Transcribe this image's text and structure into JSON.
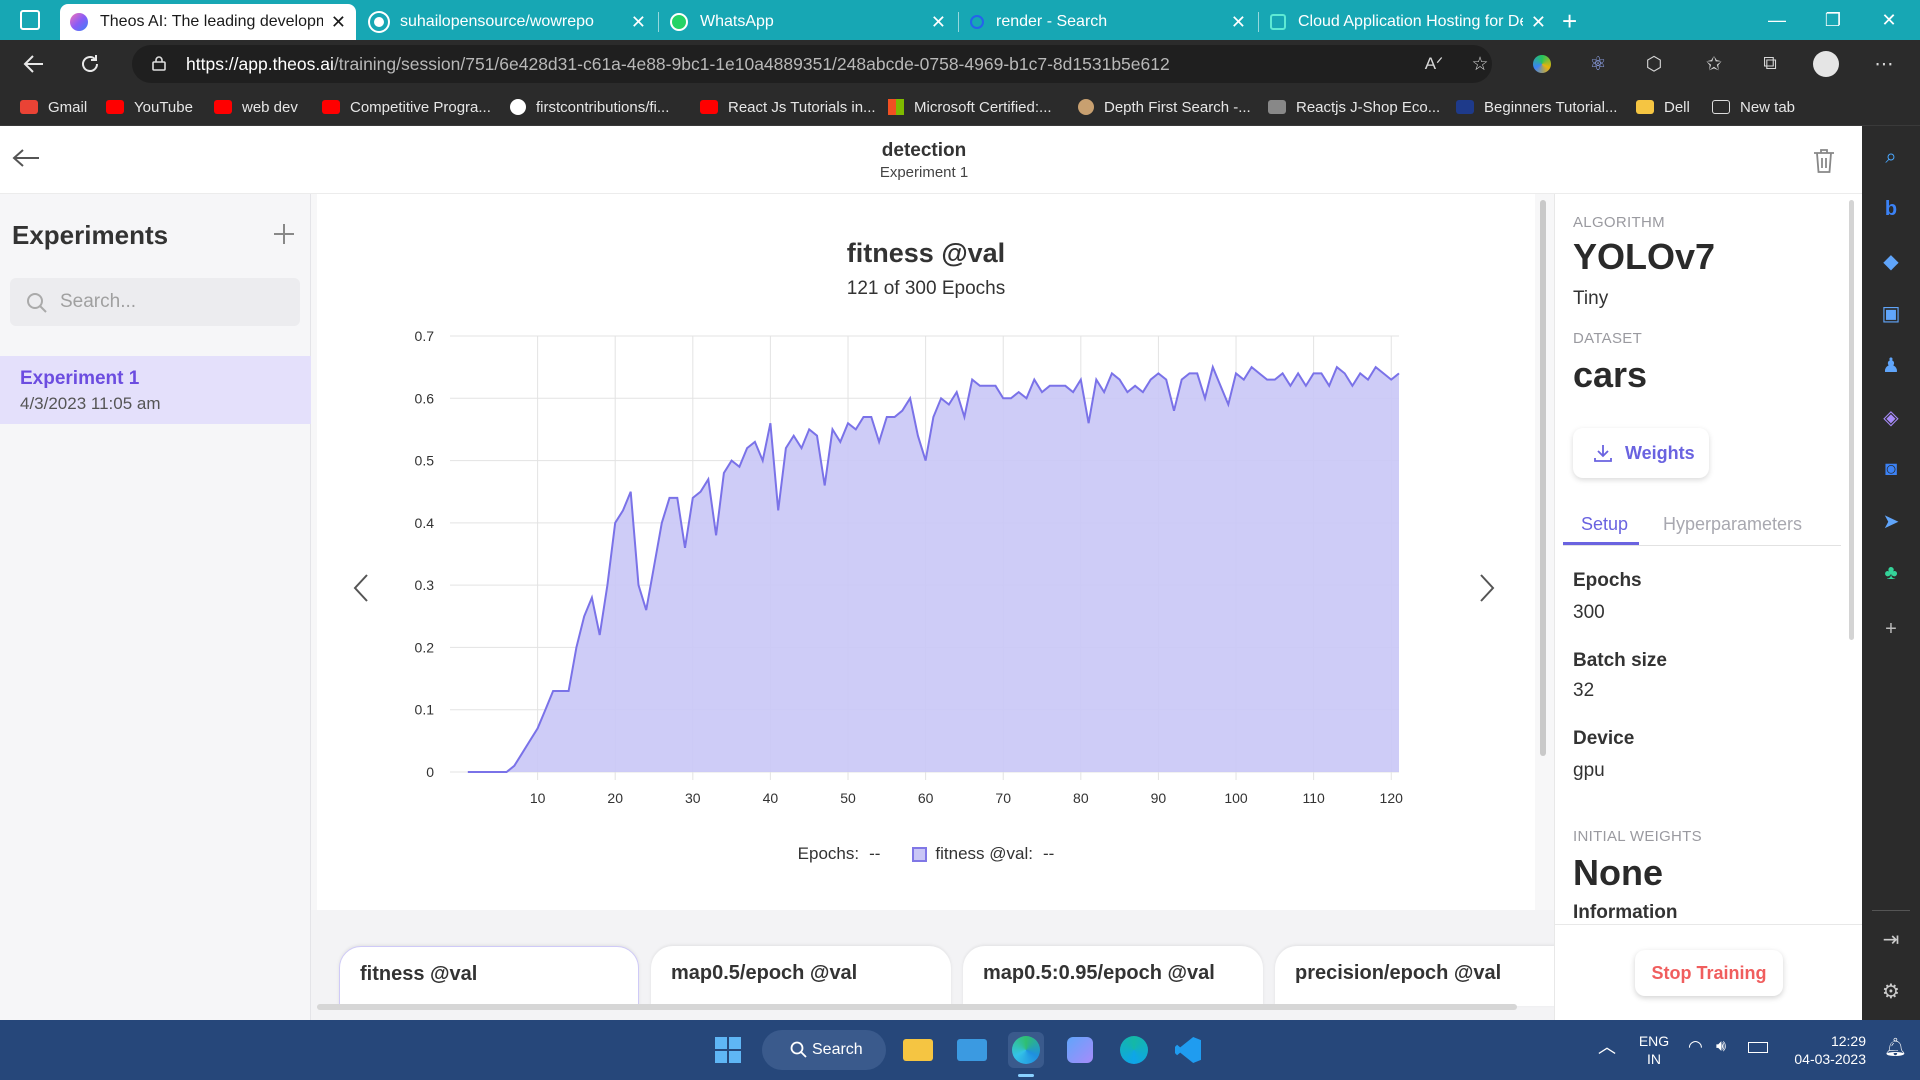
{
  "browser": {
    "tabs": [
      {
        "title": "Theos AI: The leading developme",
        "active": true,
        "icon_color": "#8b5cf6"
      },
      {
        "title": "suhailopensource/wowrepo",
        "active": false,
        "icon": "github-icon"
      },
      {
        "title": "WhatsApp",
        "active": false,
        "icon": "whatsapp-icon"
      },
      {
        "title": "render - Search",
        "active": false,
        "icon": "search-icon"
      },
      {
        "title": "Cloud Application Hosting for De",
        "active": false,
        "icon": "render-icon"
      }
    ],
    "url_host": "https://app.theos.ai",
    "url_path": "/training/session/751/6e428d31-c61a-4e88-9bc1-1e10a4889351/248abcde-0758-4969-b1c7-8d1531b5e612",
    "bookmarks": [
      {
        "label": "Gmail",
        "icon": "gmail-icon",
        "color": "#ea4335"
      },
      {
        "label": "YouTube",
        "icon": "youtube-icon",
        "color": "#ff0000"
      },
      {
        "label": "web dev",
        "icon": "youtube-icon",
        "color": "#ff0000"
      },
      {
        "label": "Competitive Progra...",
        "icon": "youtube-icon",
        "color": "#ff0000"
      },
      {
        "label": "firstcontributions/fi...",
        "icon": "github-icon",
        "color": "#ffffff"
      },
      {
        "label": "React Js Tutorials in...",
        "icon": "youtube-icon",
        "color": "#ff0000"
      },
      {
        "label": "Microsoft Certified:...",
        "icon": "microsoft-icon",
        "color": "#f25022"
      },
      {
        "label": "Depth First Search -...",
        "icon": "site-icon",
        "color": "#c8a070"
      },
      {
        "label": "Reactjs J-Shop Eco...",
        "icon": "site-icon",
        "color": "#888888"
      },
      {
        "label": "Beginners Tutorial...",
        "icon": "site-icon",
        "color": "#1e3a8a"
      },
      {
        "label": "Dell",
        "icon": "folder-icon",
        "color": "#f5c542"
      },
      {
        "label": "New tab",
        "icon": "newtab-icon",
        "color": "#dddddd"
      }
    ]
  },
  "header": {
    "title": "detection",
    "subtitle": "Experiment 1"
  },
  "sidebar": {
    "title": "Experiments",
    "search_placeholder": "Search...",
    "items": [
      {
        "name": "Experiment 1",
        "date": "4/3/2023 11:05 am"
      }
    ]
  },
  "chart_card": {
    "title": "fitness @val",
    "subtitle": "121 of 300 Epochs",
    "legend_epochs_label": "Epochs:",
    "legend_epochs_value": "--",
    "legend_series_label": "fitness @val:",
    "legend_series_value": "--"
  },
  "chart_data": {
    "type": "area",
    "x_ticks": [
      10,
      20,
      30,
      40,
      50,
      60,
      70,
      80,
      90,
      100,
      110,
      120
    ],
    "y_ticks": [
      0,
      0.1,
      0.2,
      0.3,
      0.4,
      0.5,
      0.6,
      0.7
    ],
    "xlim": [
      0,
      121
    ],
    "ylim": [
      0,
      0.7
    ],
    "grid": true,
    "colors": {
      "line": "#7a72e8",
      "fill": "#c9c6f6"
    },
    "series": [
      {
        "name": "fitness @val",
        "x": [
          1,
          2,
          3,
          4,
          5,
          6,
          7,
          8,
          9,
          10,
          11,
          12,
          13,
          14,
          15,
          16,
          17,
          18,
          19,
          20,
          21,
          22,
          23,
          24,
          25,
          26,
          27,
          28,
          29,
          30,
          31,
          32,
          33,
          34,
          35,
          36,
          37,
          38,
          39,
          40,
          41,
          42,
          43,
          44,
          45,
          46,
          47,
          48,
          49,
          50,
          51,
          52,
          53,
          54,
          55,
          56,
          57,
          58,
          59,
          60,
          61,
          62,
          63,
          64,
          65,
          66,
          67,
          68,
          69,
          70,
          71,
          72,
          73,
          74,
          75,
          76,
          77,
          78,
          79,
          80,
          81,
          82,
          83,
          84,
          85,
          86,
          87,
          88,
          89,
          90,
          91,
          92,
          93,
          94,
          95,
          96,
          97,
          98,
          99,
          100,
          101,
          102,
          103,
          104,
          105,
          106,
          107,
          108,
          109,
          110,
          111,
          112,
          113,
          114,
          115,
          116,
          117,
          118,
          119,
          120,
          121
        ],
        "y": [
          0,
          0,
          0,
          0,
          0,
          0,
          0.01,
          0.03,
          0.05,
          0.07,
          0.1,
          0.13,
          0.13,
          0.13,
          0.2,
          0.25,
          0.28,
          0.22,
          0.3,
          0.4,
          0.42,
          0.45,
          0.3,
          0.26,
          0.33,
          0.4,
          0.44,
          0.44,
          0.36,
          0.44,
          0.45,
          0.47,
          0.38,
          0.48,
          0.5,
          0.49,
          0.52,
          0.53,
          0.5,
          0.56,
          0.42,
          0.52,
          0.54,
          0.52,
          0.55,
          0.54,
          0.46,
          0.55,
          0.53,
          0.56,
          0.55,
          0.57,
          0.57,
          0.53,
          0.57,
          0.57,
          0.58,
          0.6,
          0.54,
          0.5,
          0.57,
          0.6,
          0.59,
          0.61,
          0.57,
          0.63,
          0.62,
          0.62,
          0.62,
          0.6,
          0.6,
          0.61,
          0.6,
          0.63,
          0.61,
          0.62,
          0.62,
          0.62,
          0.61,
          0.63,
          0.56,
          0.63,
          0.61,
          0.64,
          0.63,
          0.61,
          0.62,
          0.61,
          0.63,
          0.64,
          0.63,
          0.58,
          0.63,
          0.64,
          0.64,
          0.6,
          0.65,
          0.62,
          0.59,
          0.64,
          0.63,
          0.65,
          0.64,
          0.63,
          0.63,
          0.64,
          0.62,
          0.64,
          0.62,
          0.64,
          0.64,
          0.62,
          0.65,
          0.64,
          0.62,
          0.64,
          0.63,
          0.65,
          0.64,
          0.63,
          0.64
        ]
      }
    ]
  },
  "chart_tabs": [
    "fitness @val",
    "map0.5/epoch @val",
    "map0.5:0.95/epoch @val",
    "precision/epoch @val"
  ],
  "right_panel": {
    "algorithm_label": "ALGORITHM",
    "algorithm": "YOLOv7",
    "variant": "Tiny",
    "dataset_label": "DATASET",
    "dataset": "cars",
    "weights_button": "Weights",
    "tabs": [
      "Setup",
      "Hyperparameters"
    ],
    "fields": [
      {
        "label": "Epochs",
        "value": "300"
      },
      {
        "label": "Batch size",
        "value": "32"
      },
      {
        "label": "Device",
        "value": "gpu"
      }
    ],
    "initial_weights_label": "INITIAL WEIGHTS",
    "initial_weights": "None",
    "information_label": "Information",
    "stop_button": "Stop Training",
    "accent": "#6a63e0"
  },
  "taskbar": {
    "search_label": "Search",
    "lang_top": "ENG",
    "lang_bottom": "IN",
    "time": "12:29",
    "date": "04-03-2023"
  }
}
